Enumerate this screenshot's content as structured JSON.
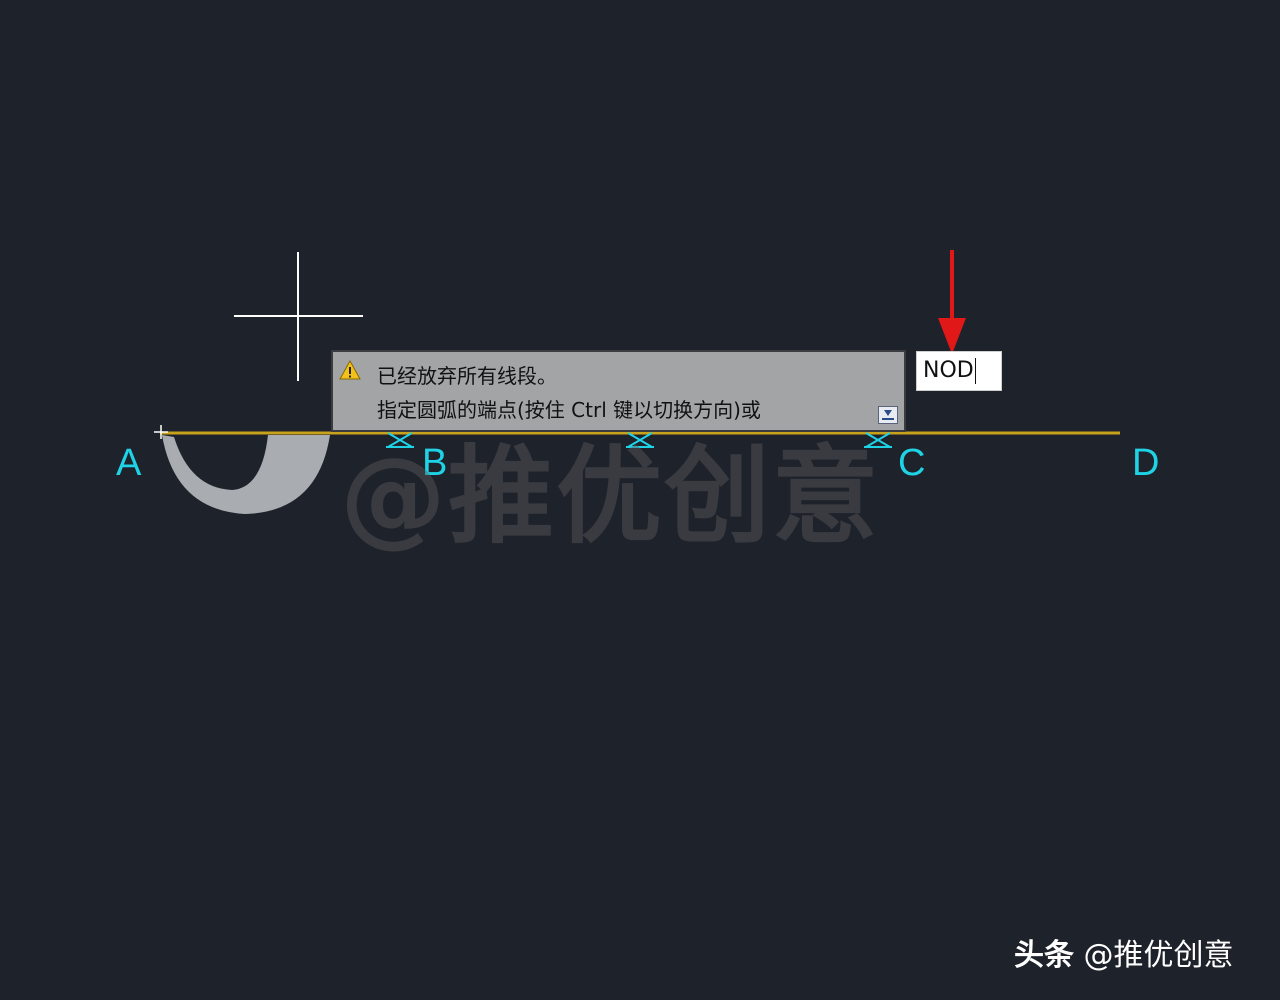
{
  "points": {
    "a": "A",
    "b": "B",
    "c": "C",
    "d": "D"
  },
  "watermark": "@推优创意",
  "prompt": {
    "line1": "已经放弃所有线段。",
    "line2": "指定圆弧的端点(按住 Ctrl 键以切换方向)或"
  },
  "command_input": {
    "value": "NOD"
  },
  "footer": {
    "platform": "头条",
    "author": "@推优创意"
  },
  "colors": {
    "background": "#1e222b",
    "line": "#c8a21a",
    "label": "#1fd3e6",
    "arrow": "#e01818",
    "arc_fill": "#a9acb0"
  }
}
